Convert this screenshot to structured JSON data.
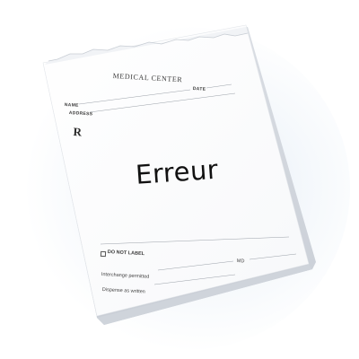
{
  "form": {
    "header_title": "MEDICAL CENTER",
    "name_label": "NAME",
    "date_label": "DATE",
    "address_label": "ADDRESS",
    "rx_symbol": "R",
    "handwritten_text": "Erreur",
    "do_not_label": "DO NOT LABEL",
    "interchange_label": "Interchange permitted",
    "md_label": "MD",
    "dispense_label": "Dispense as written"
  },
  "colors": {
    "paper": "#ffffff",
    "paper_edge": "#e6e8ec",
    "ink": "#111111",
    "print": "#3a3a3a"
  }
}
